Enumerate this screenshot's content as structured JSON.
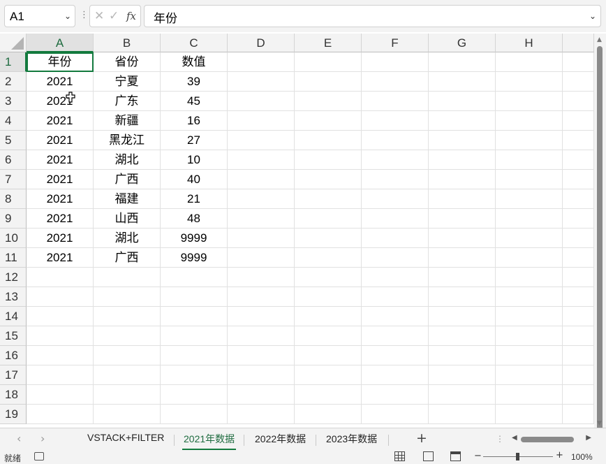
{
  "formula_bar": {
    "name_box": "A1",
    "cancel_glyph": "✕",
    "enter_glyph": "✓",
    "fx_label": "fx",
    "formula": "年份"
  },
  "columns": [
    "A",
    "B",
    "C",
    "D",
    "E",
    "F",
    "G",
    "H"
  ],
  "rows": [
    "1",
    "2",
    "3",
    "4",
    "5",
    "6",
    "7",
    "8",
    "9",
    "10",
    "11",
    "12",
    "13",
    "14",
    "15",
    "16",
    "17",
    "18",
    "19"
  ],
  "cells": [
    [
      "年份",
      "省份",
      "数值"
    ],
    [
      "2021",
      "宁夏",
      "39"
    ],
    [
      "2021",
      "广东",
      "45"
    ],
    [
      "2021",
      "新疆",
      "16"
    ],
    [
      "2021",
      "黑龙江",
      "27"
    ],
    [
      "2021",
      "湖北",
      "10"
    ],
    [
      "2021",
      "广西",
      "40"
    ],
    [
      "2021",
      "福建",
      "21"
    ],
    [
      "2021",
      "山西",
      "48"
    ],
    [
      "2021",
      "湖北",
      "9999"
    ],
    [
      "2021",
      "广西",
      "9999"
    ]
  ],
  "active_cell": "A1",
  "sheet_tabs": [
    "VSTACK+FILTER",
    "2021年数据",
    "2022年数据",
    "2023年数据"
  ],
  "active_sheet": "2021年数据",
  "status_bar": {
    "ready": "就绪",
    "zoom": "100%",
    "zoom_minus": "−",
    "zoom_plus": "+"
  },
  "icons": {
    "namebox_dropdown": "chevron-down-icon",
    "formula_dropdown": "chevron-down-icon",
    "add_sheet": "plus-icon",
    "accessibility": "accessibility-icon"
  },
  "colors": {
    "accent": "#137a3e",
    "header_bg": "#f3f3f3",
    "gridline": "#e1e1e1"
  }
}
